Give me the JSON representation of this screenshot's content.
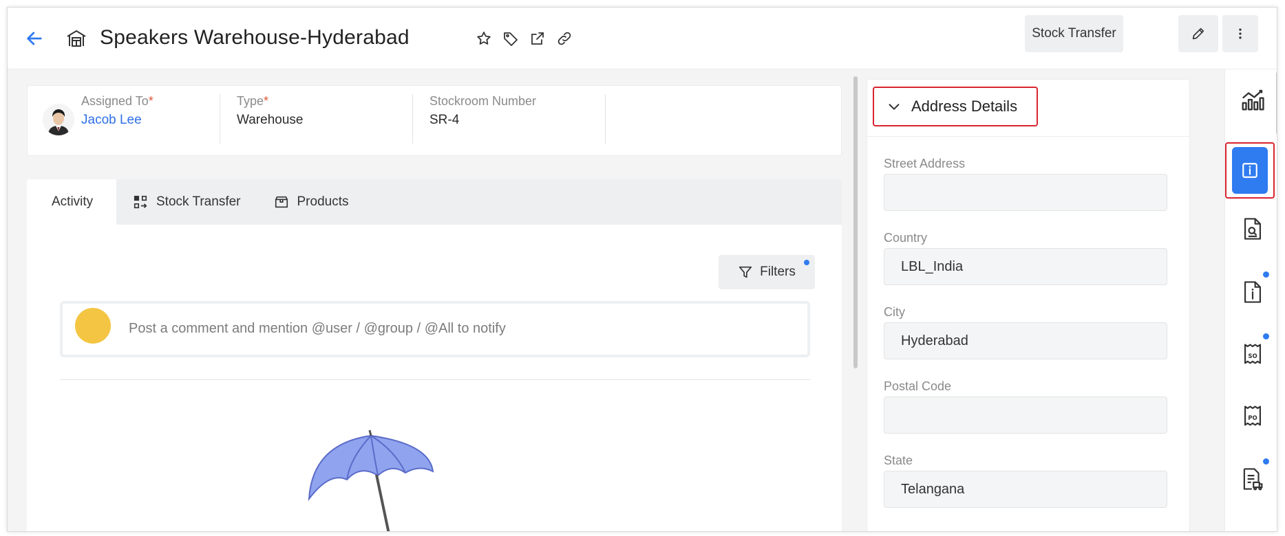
{
  "header": {
    "title": "Speakers Warehouse-Hyderabad",
    "stock_transfer_label": "Stock Transfer",
    "icons": [
      "back-arrow-icon",
      "warehouse-icon",
      "star-icon",
      "tag-icon",
      "external-link-icon",
      "link-icon",
      "pencil-icon",
      "more-vertical-icon"
    ]
  },
  "info": {
    "assigned_to": {
      "label": "Assigned To",
      "required": "*",
      "value": "Jacob Lee"
    },
    "type": {
      "label": "Type",
      "required": "*",
      "value": "Warehouse"
    },
    "stockroom_number": {
      "label": "Stockroom Number",
      "value": "SR-4"
    }
  },
  "tabs": [
    {
      "label": "Activity",
      "active": true
    },
    {
      "label": "Stock Transfer",
      "icon": "stock-transfer-icon"
    },
    {
      "label": "Products",
      "icon": "box-icon"
    }
  ],
  "activity": {
    "filters_label": "Filters",
    "comment_placeholder": "Post a comment and mention @user / @group / @All to notify"
  },
  "address": {
    "title": "Address Details",
    "fields": [
      {
        "label": "Street Address",
        "value": ""
      },
      {
        "label": "Country",
        "value": "LBL_India"
      },
      {
        "label": "City",
        "value": "Hyderabad"
      },
      {
        "label": "Postal Code",
        "value": ""
      },
      {
        "label": "State",
        "value": "Telangana"
      }
    ]
  },
  "rail": {
    "items": [
      "analytics-icon",
      "info-icon",
      "document-search-icon",
      "document-info-icon",
      "sales-order-icon",
      "purchase-order-icon",
      "invoice-icon"
    ]
  },
  "colors": {
    "accent": "#2f7bf0",
    "link": "#2f6fe8",
    "highlight": "#d9232e",
    "avatar": "#f4c542"
  }
}
